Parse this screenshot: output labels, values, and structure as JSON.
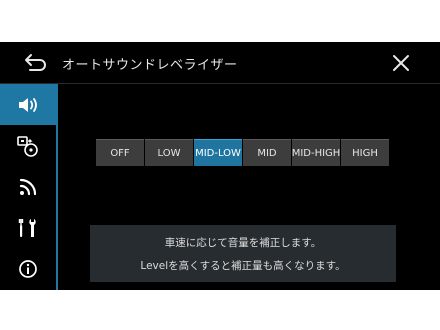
{
  "header": {
    "title": "オートサウンドレベライザー",
    "back_icon": "back-arrow-icon",
    "close_icon": "close-icon"
  },
  "sidebar": {
    "items": [
      {
        "icon": "speaker-volume-icon",
        "active": true
      },
      {
        "icon": "source-media-icon",
        "active": false
      },
      {
        "icon": "wireless-signal-icon",
        "active": false
      },
      {
        "icon": "tools-icon",
        "active": false
      },
      {
        "icon": "info-icon",
        "active": false
      }
    ]
  },
  "levels": {
    "options": [
      "OFF",
      "LOW",
      "MID-LOW",
      "MID",
      "MID-HIGH",
      "HIGH"
    ],
    "selected": "MID-LOW"
  },
  "info": {
    "line1": "車速に応じて音量を補正します。",
    "line2": "Levelを高くすると補正量も高くなります。"
  },
  "colors": {
    "accent": "#1f74a0",
    "button_bg": "#3d3d3d",
    "info_bg": "#272c31",
    "background": "#000000"
  }
}
